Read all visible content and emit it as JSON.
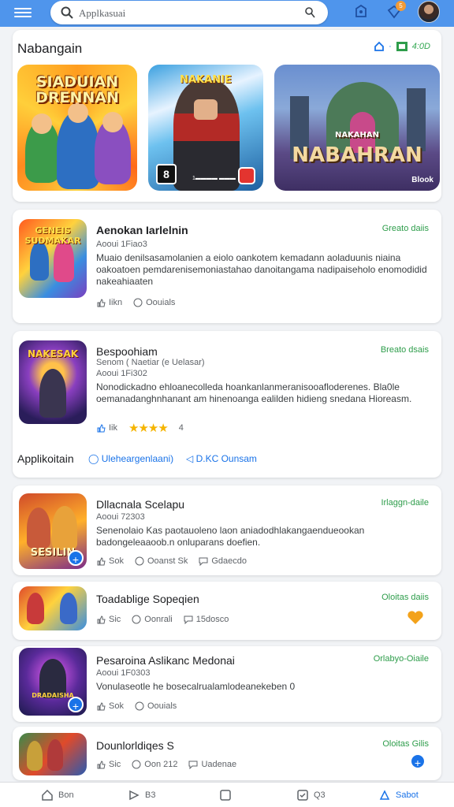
{
  "header": {
    "search_placeholder": "Applkasuai",
    "notification_count": "5"
  },
  "featured": {
    "title": "Nabangain",
    "meta_count": "4:0D",
    "banners": [
      {
        "title": "SIADUIAN DRENNAN"
      },
      {
        "title": "NAKANIE",
        "footer_text": "1▬▬▬▬ ▬▬▬"
      },
      {
        "title": "NABAHRAN",
        "subtitle": "NAKAHAN",
        "footer": "Blook"
      }
    ]
  },
  "apps": [
    {
      "name": "Aenokan Iarlelnin",
      "sub": "Aooui 1Fiao3",
      "desc": "Muaio denilsasamolanien a eiolo oankotem kemadann aoladuunis niaina oakoatoen pemdarenisemoniastahao danoitangama nadipaiseholo enomodidid nakeahiaaten",
      "stats": [
        "Iikn",
        "Oouials"
      ],
      "install": "Greato daiis",
      "icon_label": "GENEIS SUDMAKAR"
    },
    {
      "name": "Bespoohiam",
      "sub": "Senom ( Naetiar (e Uelasar)",
      "sub2": "Aooui 1Fi302",
      "desc": "Nonodickadno ehloanecolleda hoankanlanmeranisooafloderenes. Bla0le oemanadanghnhanant am hinenoanga ealilden hidieng snedana Hioreasm.",
      "stats": [
        "Iik"
      ],
      "rating": "4",
      "install": "Breato dsais",
      "footer": "Applikoitain",
      "links": [
        "Uleheargenlaani)",
        "D.KC Ounsam"
      ],
      "icon_label": "NAKESAK"
    },
    {
      "name": "Dllacnala Scelapu",
      "sub": "Aooui 72303",
      "desc": "Senenolaio Kas paotauoleno laon aniadodhlakangaendueookan badongeleaaoob.n onluparans doefien.",
      "stats": [
        "Sok",
        "Ooanst Sk",
        "Gdaecdo"
      ],
      "install": "Irlaggn-daile",
      "icon_label": "SESILIN"
    },
    {
      "name": "Toadablige Sopeqien",
      "stats": [
        "Sic",
        "Oonrali",
        "15dosco"
      ],
      "install": "Oloitas daiis"
    },
    {
      "name": "Pesaroina Aslikanc Medonai",
      "sub": "Aooui 1F0303",
      "desc": "Vonulaseotle he bosecalrualamlodeanekeben 0",
      "stats": [
        "Sok",
        "Oouials"
      ],
      "install": "Orlabyo-Oiaile",
      "icon_label": "DRADAISHA"
    },
    {
      "name": "Dounlorldiqes S",
      "stats": [
        "Sic",
        "Oon 212",
        "Uadenae"
      ],
      "install": "Oloitas Gilis"
    }
  ],
  "bottom_nav": [
    "Bon",
    "B3",
    "",
    "Q3",
    "Sabot"
  ]
}
